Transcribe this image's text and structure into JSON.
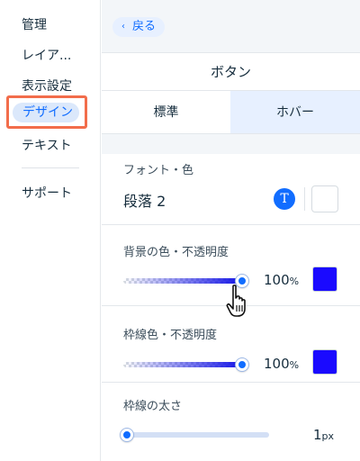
{
  "sidebar": {
    "items": [
      {
        "label": "管理"
      },
      {
        "label": "レイア..."
      },
      {
        "label": "表示設定"
      },
      {
        "label": "デザイン",
        "active": true
      },
      {
        "label": "テキスト"
      },
      {
        "label": "サポート"
      }
    ]
  },
  "header": {
    "back_label": "戻る",
    "back_icon": "chevron-left-icon"
  },
  "section": {
    "title": "ボタン"
  },
  "tabs": [
    {
      "label": "標準",
      "selected": true
    },
    {
      "label": "ホバー",
      "selected": false
    }
  ],
  "font_color": {
    "label": "フォント・色",
    "value": "段落 2",
    "text_icon": "T"
  },
  "background": {
    "label": "背景の色・不透明度",
    "opacity_value": "100",
    "unit": "%",
    "opacity_fraction": 1.0,
    "color": "#1a0aff"
  },
  "border_color": {
    "label": "枠線色・不透明度",
    "opacity_value": "100",
    "unit": "%",
    "opacity_fraction": 1.0,
    "color": "#1a0aff"
  },
  "border_width": {
    "label": "枠線の太さ",
    "value": "1",
    "unit": "px",
    "fraction": 0.0
  },
  "colors": {
    "accent": "#116dff",
    "active_bg": "#dbe8fb",
    "highlight_border": "#f26d4b"
  }
}
